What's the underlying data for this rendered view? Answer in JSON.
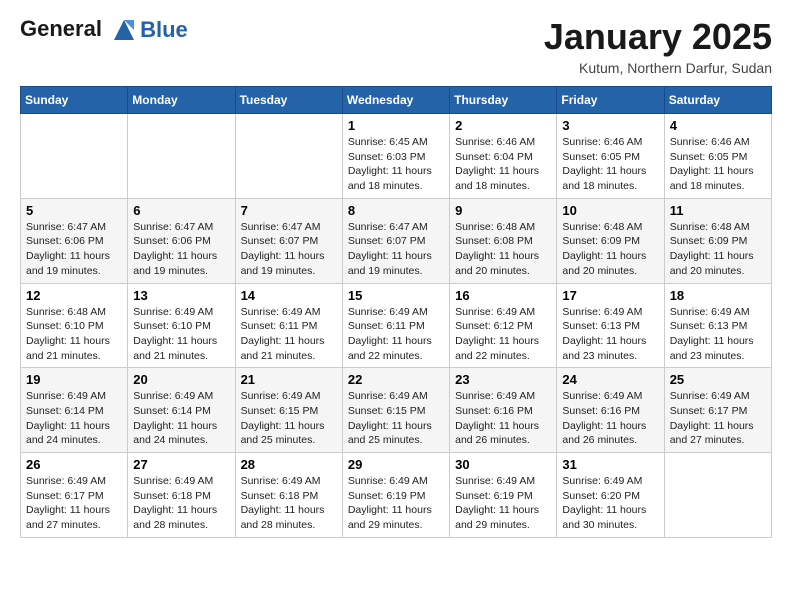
{
  "header": {
    "logo_line1": "General",
    "logo_line2": "Blue",
    "title": "January 2025",
    "subtitle": "Kutum, Northern Darfur, Sudan"
  },
  "weekdays": [
    "Sunday",
    "Monday",
    "Tuesday",
    "Wednesday",
    "Thursday",
    "Friday",
    "Saturday"
  ],
  "weeks": [
    [
      null,
      null,
      null,
      {
        "day": "1",
        "sunrise": "6:45 AM",
        "sunset": "6:03 PM",
        "daylight": "11 hours and 18 minutes."
      },
      {
        "day": "2",
        "sunrise": "6:46 AM",
        "sunset": "6:04 PM",
        "daylight": "11 hours and 18 minutes."
      },
      {
        "day": "3",
        "sunrise": "6:46 AM",
        "sunset": "6:05 PM",
        "daylight": "11 hours and 18 minutes."
      },
      {
        "day": "4",
        "sunrise": "6:46 AM",
        "sunset": "6:05 PM",
        "daylight": "11 hours and 18 minutes."
      }
    ],
    [
      {
        "day": "5",
        "sunrise": "6:47 AM",
        "sunset": "6:06 PM",
        "daylight": "11 hours and 19 minutes."
      },
      {
        "day": "6",
        "sunrise": "6:47 AM",
        "sunset": "6:06 PM",
        "daylight": "11 hours and 19 minutes."
      },
      {
        "day": "7",
        "sunrise": "6:47 AM",
        "sunset": "6:07 PM",
        "daylight": "11 hours and 19 minutes."
      },
      {
        "day": "8",
        "sunrise": "6:47 AM",
        "sunset": "6:07 PM",
        "daylight": "11 hours and 19 minutes."
      },
      {
        "day": "9",
        "sunrise": "6:48 AM",
        "sunset": "6:08 PM",
        "daylight": "11 hours and 20 minutes."
      },
      {
        "day": "10",
        "sunrise": "6:48 AM",
        "sunset": "6:09 PM",
        "daylight": "11 hours and 20 minutes."
      },
      {
        "day": "11",
        "sunrise": "6:48 AM",
        "sunset": "6:09 PM",
        "daylight": "11 hours and 20 minutes."
      }
    ],
    [
      {
        "day": "12",
        "sunrise": "6:48 AM",
        "sunset": "6:10 PM",
        "daylight": "11 hours and 21 minutes."
      },
      {
        "day": "13",
        "sunrise": "6:49 AM",
        "sunset": "6:10 PM",
        "daylight": "11 hours and 21 minutes."
      },
      {
        "day": "14",
        "sunrise": "6:49 AM",
        "sunset": "6:11 PM",
        "daylight": "11 hours and 21 minutes."
      },
      {
        "day": "15",
        "sunrise": "6:49 AM",
        "sunset": "6:11 PM",
        "daylight": "11 hours and 22 minutes."
      },
      {
        "day": "16",
        "sunrise": "6:49 AM",
        "sunset": "6:12 PM",
        "daylight": "11 hours and 22 minutes."
      },
      {
        "day": "17",
        "sunrise": "6:49 AM",
        "sunset": "6:13 PM",
        "daylight": "11 hours and 23 minutes."
      },
      {
        "day": "18",
        "sunrise": "6:49 AM",
        "sunset": "6:13 PM",
        "daylight": "11 hours and 23 minutes."
      }
    ],
    [
      {
        "day": "19",
        "sunrise": "6:49 AM",
        "sunset": "6:14 PM",
        "daylight": "11 hours and 24 minutes."
      },
      {
        "day": "20",
        "sunrise": "6:49 AM",
        "sunset": "6:14 PM",
        "daylight": "11 hours and 24 minutes."
      },
      {
        "day": "21",
        "sunrise": "6:49 AM",
        "sunset": "6:15 PM",
        "daylight": "11 hours and 25 minutes."
      },
      {
        "day": "22",
        "sunrise": "6:49 AM",
        "sunset": "6:15 PM",
        "daylight": "11 hours and 25 minutes."
      },
      {
        "day": "23",
        "sunrise": "6:49 AM",
        "sunset": "6:16 PM",
        "daylight": "11 hours and 26 minutes."
      },
      {
        "day": "24",
        "sunrise": "6:49 AM",
        "sunset": "6:16 PM",
        "daylight": "11 hours and 26 minutes."
      },
      {
        "day": "25",
        "sunrise": "6:49 AM",
        "sunset": "6:17 PM",
        "daylight": "11 hours and 27 minutes."
      }
    ],
    [
      {
        "day": "26",
        "sunrise": "6:49 AM",
        "sunset": "6:17 PM",
        "daylight": "11 hours and 27 minutes."
      },
      {
        "day": "27",
        "sunrise": "6:49 AM",
        "sunset": "6:18 PM",
        "daylight": "11 hours and 28 minutes."
      },
      {
        "day": "28",
        "sunrise": "6:49 AM",
        "sunset": "6:18 PM",
        "daylight": "11 hours and 28 minutes."
      },
      {
        "day": "29",
        "sunrise": "6:49 AM",
        "sunset": "6:19 PM",
        "daylight": "11 hours and 29 minutes."
      },
      {
        "day": "30",
        "sunrise": "6:49 AM",
        "sunset": "6:19 PM",
        "daylight": "11 hours and 29 minutes."
      },
      {
        "day": "31",
        "sunrise": "6:49 AM",
        "sunset": "6:20 PM",
        "daylight": "11 hours and 30 minutes."
      },
      null
    ]
  ]
}
